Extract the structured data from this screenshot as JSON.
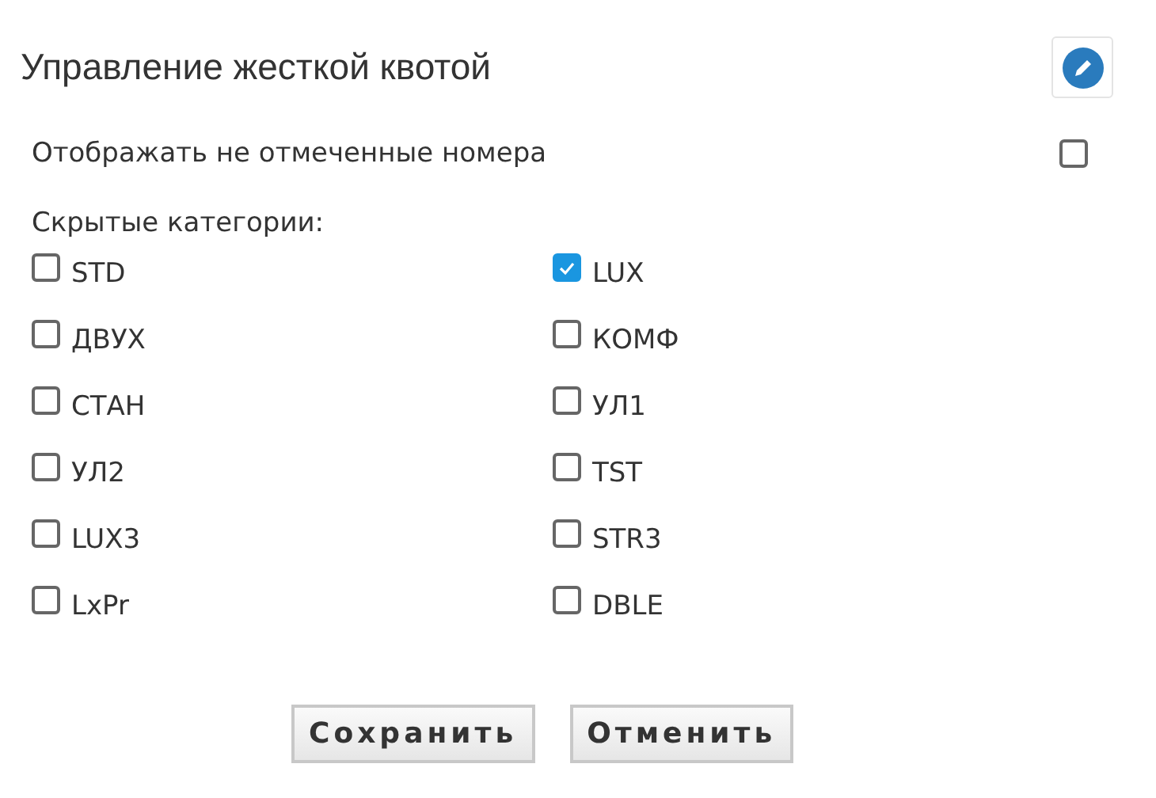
{
  "title": "Управление жесткой квотой",
  "show_unmarked": {
    "label": "Отображать не отмеченные номера",
    "checked": false
  },
  "hidden_categories": {
    "label": "Скрытые категории:",
    "items": [
      {
        "label": "STD",
        "checked": false
      },
      {
        "label": "LUX",
        "checked": true
      },
      {
        "label": "ДВУХ",
        "checked": false
      },
      {
        "label": "КОМФ",
        "checked": false
      },
      {
        "label": "СТАН",
        "checked": false
      },
      {
        "label": "УЛ1",
        "checked": false
      },
      {
        "label": "УЛ2",
        "checked": false
      },
      {
        "label": "TST",
        "checked": false
      },
      {
        "label": "LUX3",
        "checked": false
      },
      {
        "label": "STR3",
        "checked": false
      },
      {
        "label": "LxPr",
        "checked": false
      },
      {
        "label": "DBLE",
        "checked": false
      }
    ]
  },
  "buttons": [
    {
      "label": "Сохранить"
    },
    {
      "label": "Отменить"
    }
  ]
}
